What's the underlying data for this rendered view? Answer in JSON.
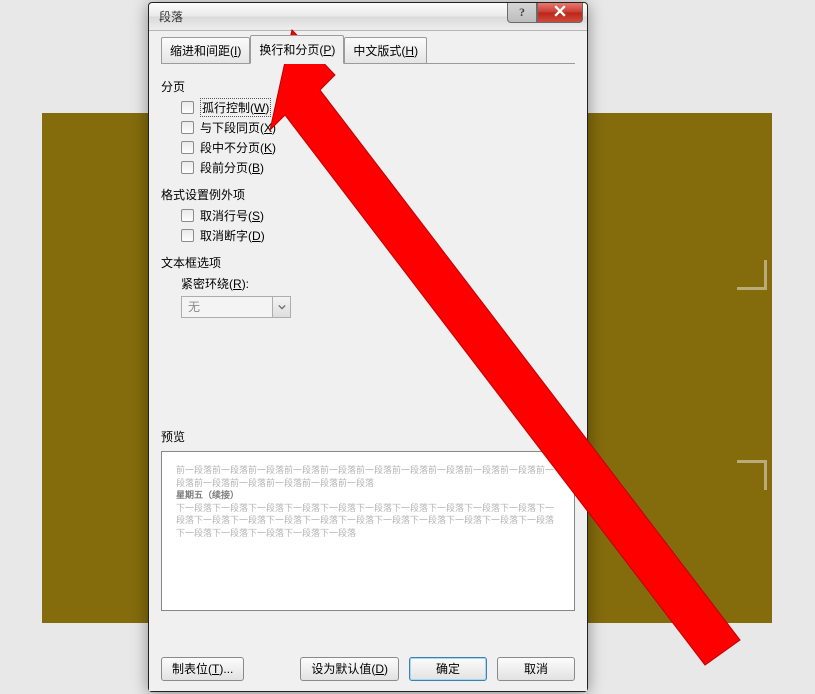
{
  "dialog": {
    "title": "段落",
    "help_symbol": "?",
    "tabs": [
      {
        "label": "缩进和间距",
        "hotkey": "I"
      },
      {
        "label": "换行和分页",
        "hotkey": "P"
      },
      {
        "label": "中文版式",
        "hotkey": "H"
      }
    ],
    "active_tab_index": 1
  },
  "pagination": {
    "group_label": "分页",
    "items": [
      {
        "label": "孤行控制",
        "hotkey": "W",
        "focused": true
      },
      {
        "label": "与下段同页",
        "hotkey": "X",
        "focused": false
      },
      {
        "label": "段中不分页",
        "hotkey": "K",
        "focused": false
      },
      {
        "label": "段前分页",
        "hotkey": "B",
        "focused": false
      }
    ]
  },
  "format_exceptions": {
    "group_label": "格式设置例外项",
    "items": [
      {
        "label": "取消行号",
        "hotkey": "S"
      },
      {
        "label": "取消断字",
        "hotkey": "D"
      }
    ]
  },
  "textbox_options": {
    "group_label": "文本框选项",
    "wrap_label": "紧密环绕",
    "wrap_hotkey": "R",
    "wrap_value": "无"
  },
  "preview": {
    "label": "预览",
    "before_text": "前一段落前一段落前一段落前一段落前一段落前一段落前一段落前一段落前一段落前一段落前一段落前一段落前一段落前一段落前一段落前一段落",
    "bold_text": "星期五（续接）",
    "after_text": "下一段落下一段落下一段落下一段落下一段落下一段落下一段落下一段落下一段落下一段落下一段落下一段落下一段落下一段落下一段落下一段落下一段落下一段落下一段落下一段落下一段落下一段落下一段落下一段落下一段落下一段落"
  },
  "footer": {
    "tabstops": {
      "label": "制表位",
      "hotkey": "T",
      "suffix": "..."
    },
    "default": {
      "label": "设为默认值",
      "hotkey": "D"
    },
    "ok": "确定",
    "cancel": "取消"
  }
}
